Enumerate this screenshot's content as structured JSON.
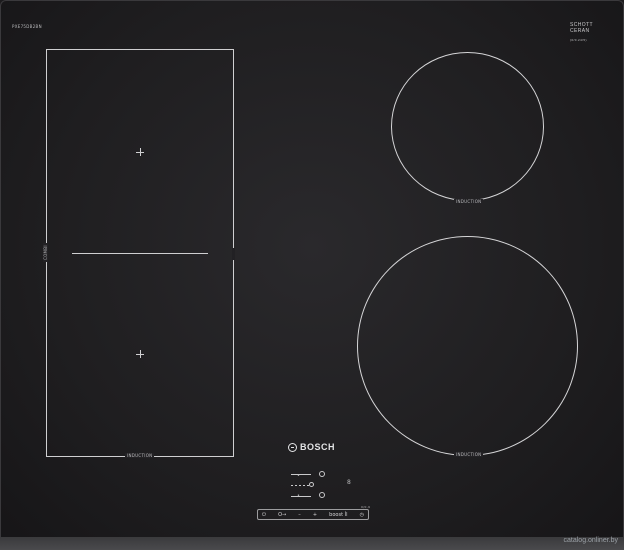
{
  "model_code": "PXE75DB2BN",
  "schott": {
    "line1": "SCHOTT",
    "line2": "CERAN",
    "sub": "(0/0.24/5)"
  },
  "zones": {
    "combi_label": "COMBI",
    "flex_label": "INDUCTION",
    "top_right_label": "INDUCTION",
    "bottom_right_label": "INDUCTION"
  },
  "brand": "BOSCH",
  "controls": {
    "pause_label": "II",
    "lock_label": "O→",
    "minus_label": "–",
    "plus_label": "+",
    "boost_label": "boost İl",
    "timer_label": "◷",
    "power_label": "⏻",
    "ringtag": "0/0.9"
  },
  "watermark": "catalog.onliner.by"
}
